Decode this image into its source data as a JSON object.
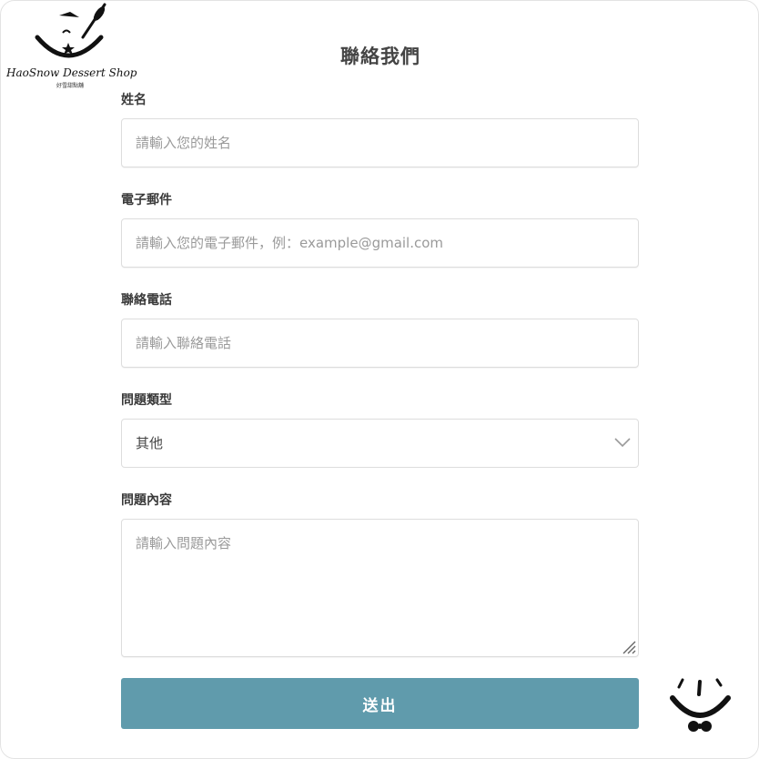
{
  "brand": {
    "name": "HaoSnow Dessert Shop",
    "subname": "好雪甜點舖"
  },
  "page": {
    "title": "聯絡我們"
  },
  "form": {
    "name": {
      "label": "姓名",
      "placeholder": "請輸入您的姓名",
      "value": ""
    },
    "email": {
      "label": "電子郵件",
      "placeholder": "請輸入您的電子郵件，例：example@gmail.com",
      "value": ""
    },
    "phone": {
      "label": "聯絡電話",
      "placeholder": "請輸入聯絡電話",
      "value": ""
    },
    "type": {
      "label": "問題類型",
      "selected": "其他"
    },
    "content": {
      "label": "問題內容",
      "placeholder": "請輸入問題內容",
      "value": ""
    },
    "submit_label": "送出"
  },
  "icons": {
    "logo": "dessert-shop-logo-icon",
    "chevron": "chevron-down-icon",
    "resize": "resize-grip-icon",
    "mascot": "smiley-bowtie-icon"
  },
  "colors": {
    "accent": "#609bac",
    "border": "#dddddd",
    "title": "#444444"
  }
}
